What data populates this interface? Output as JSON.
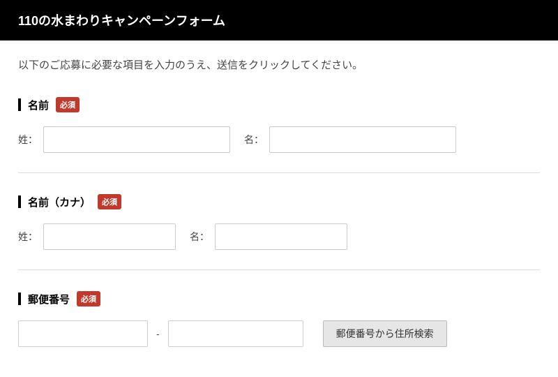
{
  "header": {
    "title": "110の水まわりキャンペーンフォーム"
  },
  "instruction": "以下のご応募に必要な項目を入力のうえ、送信をクリックしてください。",
  "required_label": "必須",
  "sections": {
    "name": {
      "title": "名前",
      "sei_label": "姓：",
      "mei_label": "名：",
      "sei_value": "",
      "mei_value": ""
    },
    "kana": {
      "title": "名前（カナ）",
      "sei_label": "姓：",
      "mei_label": "名：",
      "sei_value": "",
      "mei_value": ""
    },
    "zip": {
      "title": "郵便番号",
      "sep": "-",
      "zip1_value": "",
      "zip2_value": "",
      "search_button": "郵便番号から住所検索"
    }
  }
}
